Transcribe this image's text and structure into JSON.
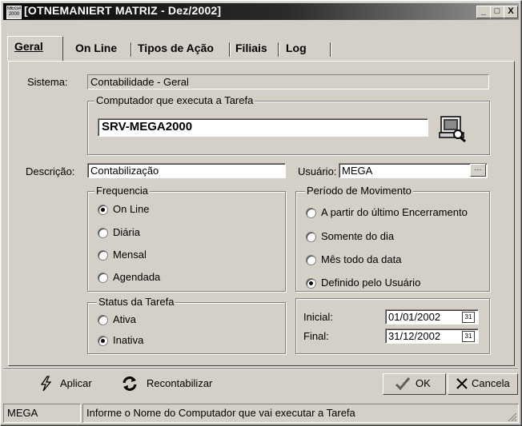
{
  "window": {
    "title": "[OTNEMANIERT MATRIZ - Dez/2002]",
    "app_icon_text": "MEGA 2000",
    "minimize": "_",
    "maximize": "□",
    "close": "X"
  },
  "tabs": [
    {
      "label": "Geral",
      "accel": "G",
      "active": true
    },
    {
      "label": "On Line",
      "accel": "O",
      "active": false
    },
    {
      "label": "Tipos de Ação",
      "accel": "T",
      "active": false
    },
    {
      "label": "Filiais",
      "accel": "F",
      "active": false
    },
    {
      "label": "Log",
      "accel": "L",
      "active": false
    }
  ],
  "sistema": {
    "label": "Sistema:",
    "value": "Contabilidade - Geral"
  },
  "computador": {
    "group_title": "Computador que executa a Tarefa",
    "value": "SRV-MEGA2000",
    "icon": "computer-search-icon"
  },
  "descricao": {
    "label": "Descrição:",
    "value": "Contabilização"
  },
  "usuario": {
    "label": "Usuário:",
    "value": "MEGA",
    "button": "···"
  },
  "frequencia": {
    "title": "Frequencia",
    "options": [
      {
        "label": "On Line",
        "checked": true
      },
      {
        "label": "Diária",
        "checked": false
      },
      {
        "label": "Mensal",
        "checked": false
      },
      {
        "label": "Agendada",
        "checked": false
      }
    ]
  },
  "periodo": {
    "title": "Período de Movimento",
    "options": [
      {
        "label": "A partir do último Encerramento",
        "checked": false
      },
      {
        "label": "Somente do dia",
        "checked": false
      },
      {
        "label": "Mês todo da data",
        "checked": false
      },
      {
        "label": "Definido pelo Usuário",
        "checked": true
      }
    ]
  },
  "status": {
    "title": "Status da Tarefa",
    "options": [
      {
        "label": "Ativa",
        "checked": false
      },
      {
        "label": "Inativa",
        "checked": true
      }
    ]
  },
  "datas": {
    "inicial_label": "Inicial:",
    "inicial_value": "01/01/2002",
    "final_label": "Final:",
    "final_value": "31/12/2002",
    "cal_glyph": "31"
  },
  "toolbar": {
    "aplicar": "Aplicar",
    "recontabilizar": "Recontabilizar",
    "ok": "OK",
    "cancela": "Cancela"
  },
  "statusbar": {
    "user": "MEGA",
    "message": "Informe o Nome do Computador que vai executar a Tarefa"
  }
}
